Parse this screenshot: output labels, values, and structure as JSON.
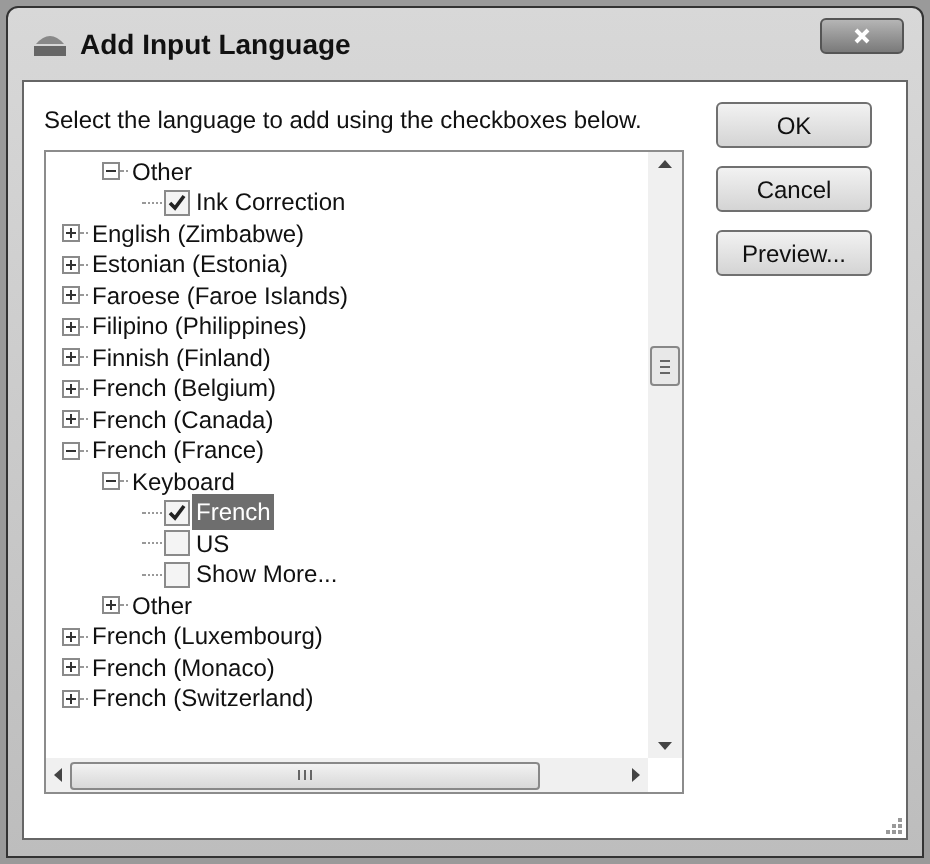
{
  "window": {
    "title": "Add Input Language"
  },
  "instruction": "Select the language to add using the checkboxes below.",
  "tree": {
    "continued": [
      {
        "kind": "node",
        "label": "Other",
        "expanded": true,
        "children": [
          {
            "kind": "checkbox",
            "label": "Ink Correction",
            "checked": true,
            "selected": false
          }
        ]
      }
    ],
    "items": [
      {
        "kind": "node",
        "label": "English (Zimbabwe)",
        "expanded": false
      },
      {
        "kind": "node",
        "label": "Estonian (Estonia)",
        "expanded": false
      },
      {
        "kind": "node",
        "label": "Faroese (Faroe Islands)",
        "expanded": false
      },
      {
        "kind": "node",
        "label": "Filipino (Philippines)",
        "expanded": false
      },
      {
        "kind": "node",
        "label": "Finnish (Finland)",
        "expanded": false
      },
      {
        "kind": "node",
        "label": "French (Belgium)",
        "expanded": false
      },
      {
        "kind": "node",
        "label": "French (Canada)",
        "expanded": false
      },
      {
        "kind": "node",
        "label": "French (France)",
        "expanded": true,
        "children": [
          {
            "kind": "node",
            "label": "Keyboard",
            "expanded": true,
            "children": [
              {
                "kind": "checkbox",
                "label": "French",
                "checked": true,
                "selected": true
              },
              {
                "kind": "checkbox",
                "label": "US",
                "checked": false,
                "selected": false
              },
              {
                "kind": "checkbox",
                "label": "Show More...",
                "checked": false,
                "selected": false
              }
            ]
          },
          {
            "kind": "node",
            "label": "Other",
            "expanded": false
          }
        ]
      },
      {
        "kind": "node",
        "label": "French (Luxembourg)",
        "expanded": false
      },
      {
        "kind": "node",
        "label": "French (Monaco)",
        "expanded": false
      },
      {
        "kind": "node",
        "label": "French (Switzerland)",
        "expanded": false
      }
    ]
  },
  "buttons": [
    "OK",
    "Cancel",
    "Preview..."
  ]
}
